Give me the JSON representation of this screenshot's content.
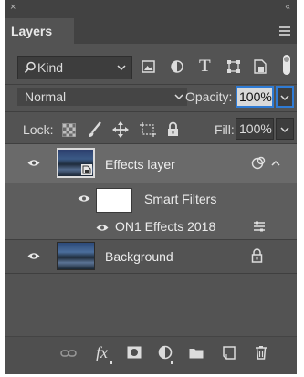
{
  "window": {
    "close_glyph": "×",
    "collapse_glyph": "‹‹"
  },
  "panel": {
    "tab_title": "Layers",
    "menu_icon": "panel-menu-icon"
  },
  "filter": {
    "kind_label": "Kind",
    "kind_icon": "search-icon",
    "icons": [
      "image-filter-icon",
      "adjustment-filter-icon",
      "type-filter-icon",
      "shape-filter-icon",
      "smart-object-filter-icon",
      "filter-toggle-icon"
    ]
  },
  "blend": {
    "mode": "Normal",
    "opacity_label": "Opacity:",
    "opacity_value": "100%"
  },
  "lock": {
    "label": "Lock:",
    "icons": [
      "lock-transparent-icon",
      "lock-paint-icon",
      "lock-move-icon",
      "lock-artboard-icon",
      "lock-all-icon"
    ],
    "fill_label": "Fill:",
    "fill_value": "100%"
  },
  "layers": [
    {
      "name": "Effects layer",
      "visible": true,
      "selected": true,
      "type": "smart-object"
    },
    {
      "name": "Smart Filters",
      "visible": true,
      "type": "smart-filters"
    },
    {
      "name": "ON1 Effects 2018",
      "visible": true,
      "type": "filter"
    },
    {
      "name": "Background",
      "visible": true,
      "locked": true,
      "type": "image"
    }
  ],
  "footer": {
    "fx_label": "fx",
    "icons": [
      "link-layers-icon",
      "fx-icon",
      "layer-mask-icon",
      "adjustment-layer-icon",
      "new-group-icon",
      "new-layer-icon",
      "trash-icon"
    ]
  },
  "colors": {
    "panel_bg": "#535353",
    "header_bg": "#424242",
    "selected_row": "#6a6a6a",
    "focus_blue": "#2f7bd4"
  }
}
